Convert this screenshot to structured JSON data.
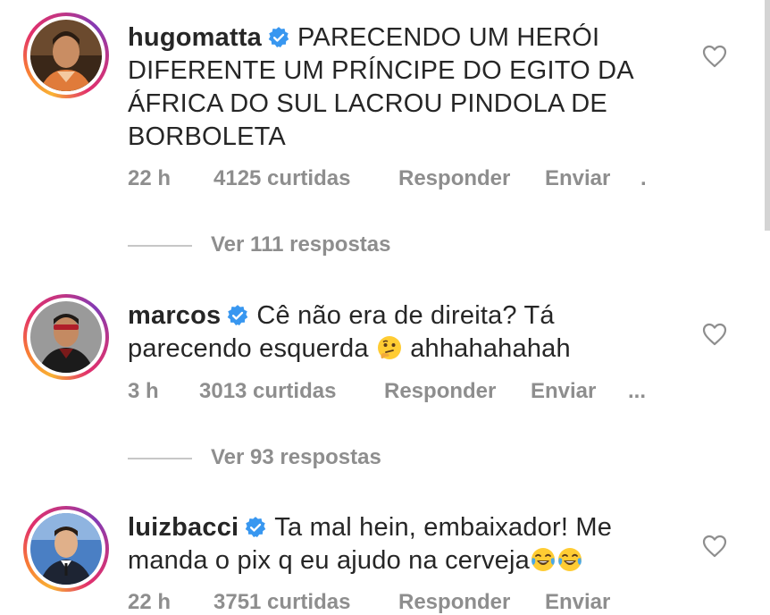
{
  "comments": [
    {
      "username": "hugomatta",
      "verified": true,
      "text": "PARECENDO UM HERÓI DIFERENTE UM PRÍNCIPE DO EGITO DA ÁFRICA DO SUL LACROU PINDOLA DE BORBOLETA",
      "time": "22 h",
      "likes": "4125 curtidas",
      "reply_label": "Responder",
      "send_label": "Enviar",
      "more": ".",
      "view_replies": "Ver 111 respostas"
    },
    {
      "username": "marcos",
      "verified": true,
      "text_before_emoji": "Cê não era de direita? Tá parecendo esquerda",
      "emoji": "thinking-face",
      "text_after_emoji": "ahhahahahah",
      "time": "3 h",
      "likes": "3013 curtidas",
      "reply_label": "Responder",
      "send_label": "Enviar",
      "more": "...",
      "view_replies": "Ver 93 respostas"
    },
    {
      "username": "luizbacci",
      "verified": true,
      "text": "Ta mal hein, embaixador! Me manda o pix q eu ajudo na cerveja",
      "emoji": "face-with-tears-of-joy",
      "time": "22 h",
      "likes": "3751 curtidas",
      "reply_label": "Responder",
      "send_label": "Enviar"
    }
  ],
  "colors": {
    "text": "#262626",
    "secondary": "#8e8e8e",
    "verified_blue": "#3897f0",
    "divider": "#c7c7c7"
  }
}
